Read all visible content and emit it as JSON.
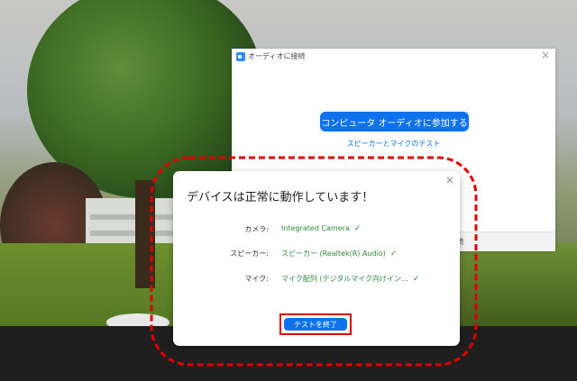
{
  "join_dialog": {
    "title": "オーディオに接続",
    "close_icon": "×",
    "join_button": "コンピュータ オーディオに参加する",
    "test_link": "スピーカーとマイクのテスト",
    "footer_text": "続"
  },
  "test_dialog": {
    "close_icon": "×",
    "heading": "デバイスは正常に動作しています！",
    "rows": [
      {
        "label": "カメラ:",
        "value": "Integrated Camera",
        "check": "✓"
      },
      {
        "label": "スピーカー:",
        "value": "スピーカー (Realtek(R) Audio)",
        "check": "✓"
      },
      {
        "label": "マイク:",
        "value": "マイク配列 (デジタルマイク向けイン...",
        "check": "✓"
      }
    ],
    "end_button": "テストを終了"
  },
  "colors": {
    "accent": "#0e72ed",
    "status_ok": "#2f8a3b",
    "annotation": "#e00000"
  },
  "icons": {
    "app": "zoom-icon",
    "close": "close-icon",
    "check": "check-icon"
  }
}
